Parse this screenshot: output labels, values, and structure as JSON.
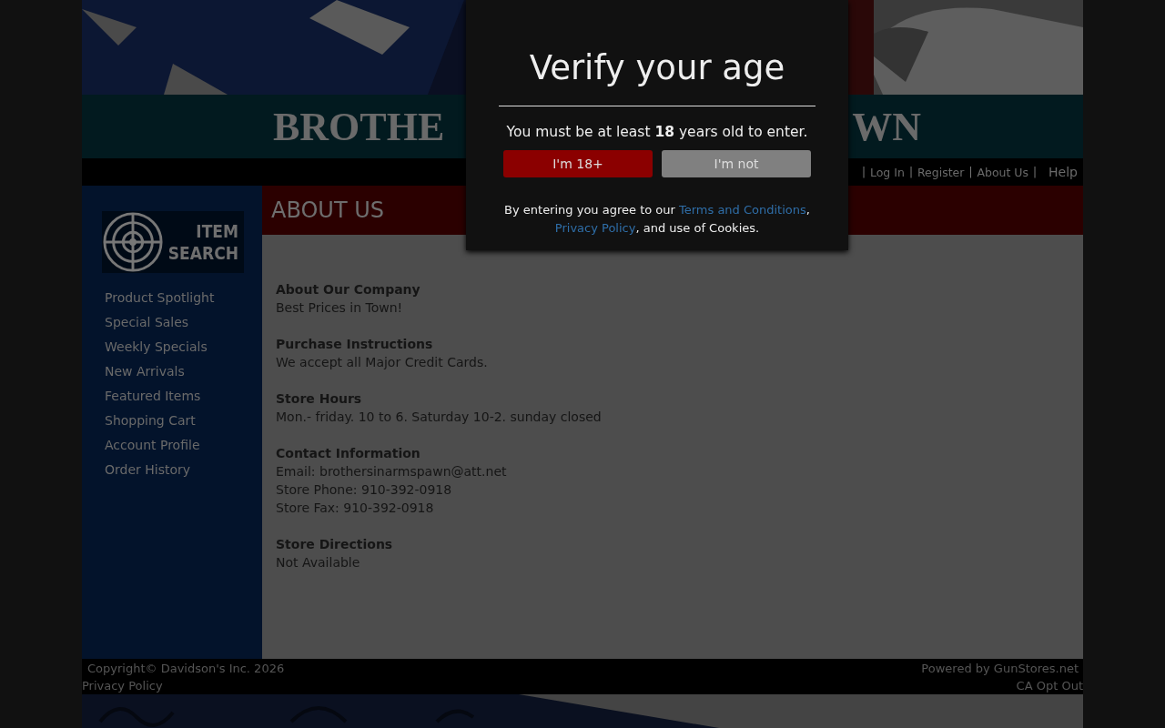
{
  "banner": {
    "left": "BROTHE",
    "right": "WN"
  },
  "nav": {
    "separator": "|",
    "items": [
      {
        "label": "Log In"
      },
      {
        "label": "Register"
      },
      {
        "label": "About Us"
      }
    ],
    "help": "Help"
  },
  "sidebar": {
    "search_logo": [
      "ITEM",
      "SEARCH"
    ],
    "items": [
      {
        "label": "Product Spotlight"
      },
      {
        "label": "Special Sales"
      },
      {
        "label": "Weekly Specials"
      },
      {
        "label": "New Arrivals"
      },
      {
        "label": "Featured Items"
      },
      {
        "label": "Shopping Cart"
      },
      {
        "label": "Account Profile"
      },
      {
        "label": "Order History"
      }
    ]
  },
  "page_title": "ABOUT US",
  "sections": [
    {
      "heading": "About Our Company",
      "lines": [
        "Best Prices in Town!"
      ]
    },
    {
      "heading": "Purchase Instructions",
      "lines": [
        "We accept all Major Credit Cards."
      ]
    },
    {
      "heading": "Store Hours",
      "lines": [
        "Mon.- friday. 10 to 6. Saturday 10-2. sunday closed"
      ]
    },
    {
      "heading": "Contact Information",
      "lines": [
        "Email: brothersinarmspawn@att.net",
        "Store Phone: 910-392-0918",
        "Store Fax: 910-392-0918"
      ]
    },
    {
      "heading": "Store Directions",
      "lines": [
        "Not Available"
      ]
    }
  ],
  "footer": {
    "copyright": "Copyright© Davidson's Inc. 2026",
    "privacy": "Privacy Policy",
    "powered": "Powered by GunStores.net",
    "opt_out": "CA Opt Out"
  },
  "modal": {
    "title": "Verify your age",
    "message": "You must be at least **18** years old to enter.",
    "buttons": [
      {
        "label": "I'm 18+",
        "kind": "accept"
      },
      {
        "label": "I'm not",
        "kind": "decline"
      }
    ],
    "agree_before": "By entering you agree to our",
    "terms_link": "Terms and Conditions",
    "comma": ",",
    "privacy_link": "Privacy Policy",
    "agree_after": ", and use of Cookies."
  }
}
